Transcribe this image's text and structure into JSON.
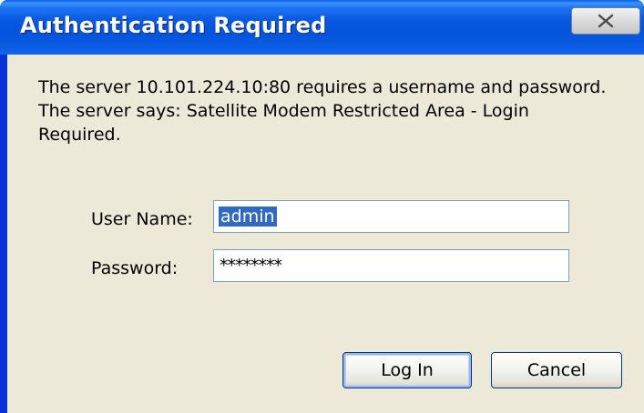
{
  "window": {
    "title": "Authentication Required"
  },
  "message": {
    "line1": "The server 10.101.224.10:80 requires a username and password.",
    "line2": "The server says: Satellite Modem Restricted Area - Login",
    "line3": "Required."
  },
  "form": {
    "username_label": "User Name:",
    "username_value": "admin",
    "password_label": "Password:",
    "password_value": "********"
  },
  "buttons": {
    "login_label": "Log In",
    "cancel_label": "Cancel"
  },
  "icons": {
    "close": "close-icon"
  },
  "colors": {
    "titlebar": "#0a5be3",
    "client_background": "#ece9d8",
    "selection": "#316ac5",
    "input_border": "#7f9db9"
  }
}
